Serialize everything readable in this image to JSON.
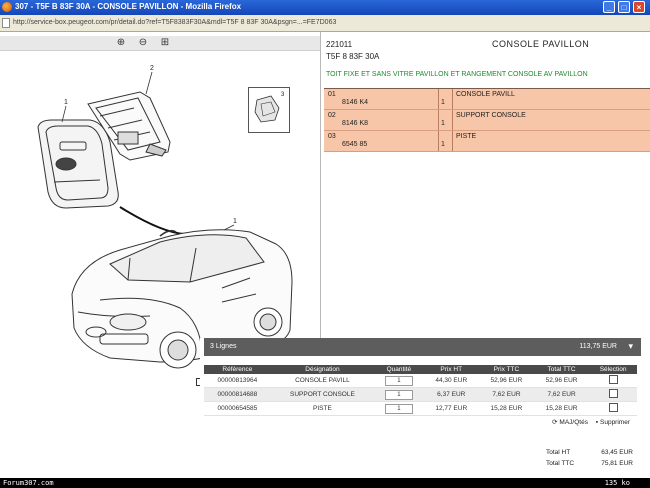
{
  "window": {
    "title": "307 - T5F B 83F 30A - CONSOLE PAVILLON - Mozilla Firefox",
    "controls": [
      "_",
      "□",
      "×"
    ]
  },
  "address": {
    "url": "http://service-box.peugeot.com/pr/detail.do?ref=T5F8383F30A&mdl=T5F 8 83F 30A&psgn=...=FE7D063"
  },
  "viewer": {
    "zoom_in_icon": "zoom-in-icon",
    "zoom_out_icon": "zoom-out-icon",
    "zoom_fit_icon": "zoom-fit-icon",
    "callouts": [
      "1",
      "2",
      "3",
      "1"
    ]
  },
  "part": {
    "reference": "221011",
    "title": "CONSOLE PAVILLON",
    "model_code": "T5F 8 83F 30A",
    "description": "TOIT FIXE ET SANS VITRE PAVILLON ET RANGEMENT CONSOLE AV PAVILLON",
    "rows": [
      {
        "num": "01",
        "ref": "8146 K4",
        "qty": "1",
        "name": "CONSOLE PAVILL"
      },
      {
        "num": "02",
        "ref": "8146 K8",
        "qty": "1",
        "name": "SUPPORT CONSOLE"
      },
      {
        "num": "03",
        "ref": "6545 85",
        "qty": "1",
        "name": "PISTE"
      }
    ]
  },
  "cart": {
    "header_label": "3 Lignes",
    "header_total": "113,75 EUR",
    "header_arrow": "▾",
    "columns": [
      "Référence",
      "Désignation",
      "Quantité",
      "Prix HT",
      "Prix TTC",
      "Total TTC",
      "Sélection"
    ],
    "rows": [
      {
        "ref": "00000813964",
        "designation": "CONSOLE PAVILL",
        "qty": "1",
        "price_ht": "44,30 EUR",
        "price_ttc": "52,96 EUR",
        "total_ttc": "52,96 EUR"
      },
      {
        "ref": "00000814688",
        "designation": "SUPPORT CONSOLE",
        "qty": "1",
        "price_ht": "6,37 EUR",
        "price_ttc": "7,62 EUR",
        "total_ttc": "7,62 EUR"
      },
      {
        "ref": "00000654585",
        "designation": "PISTE",
        "qty": "1",
        "price_ht": "12,77 EUR",
        "price_ttc": "15,28 EUR",
        "total_ttc": "15,28 EUR"
      }
    ],
    "update_label": "MAJ/Qtés",
    "delete_label": "Supprimer",
    "total_ht_label": "Total HT",
    "total_ht_value": "63,45 EUR",
    "total_ttc_label": "Total TTC",
    "total_ttc_value": "75,81 EUR"
  },
  "footer": {
    "site": "Forum307.com",
    "size": "135 ko"
  }
}
